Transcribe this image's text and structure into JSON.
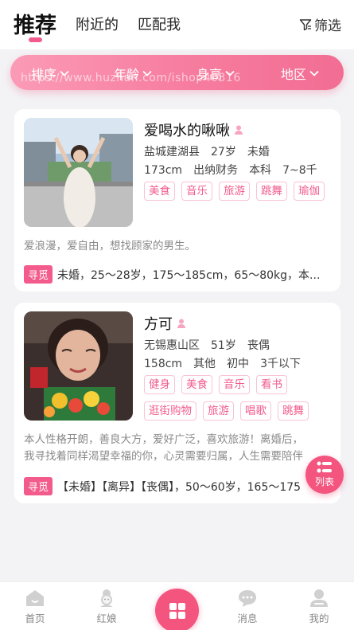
{
  "header": {
    "tab_recommend": "推荐",
    "tab_nearby": "附近的",
    "tab_match": "匹配我",
    "filter_label": "筛选"
  },
  "filter_bar": {
    "sort": "排序",
    "age": "年龄",
    "height": "身高",
    "region": "地区",
    "watermark": "https://www.huzhan.com/ishop40316"
  },
  "cards": [
    {
      "name": "爱喝水的啾啾",
      "location": "盐城建湖县",
      "age": "27岁",
      "marital": "未婚",
      "height": "173cm",
      "job": "出纳财务",
      "education": "本科",
      "income": "7~8千",
      "tags": [
        "美食",
        "音乐",
        "旅游",
        "跳舞",
        "瑜伽"
      ],
      "bio": "爱浪漫，爱自由，想找顾家的男生。",
      "seek_label": "寻觅",
      "seek_text": "未婚，25～28岁，175～185cm，65～80kg，本..."
    },
    {
      "name": "方可",
      "location": "无锡惠山区",
      "age": "51岁",
      "marital": "丧偶",
      "height": "158cm",
      "job": "其他",
      "education": "初中",
      "income": "3千以下",
      "tags": [
        "健身",
        "美食",
        "音乐",
        "看书",
        "逛街购物",
        "旅游",
        "唱歌",
        "跳舞"
      ],
      "bio": "本人性格开朗，善良大方，爱好广泛，喜欢旅游！离婚后，我寻找着同样渴望幸福的你，心灵需要归属，人生需要陪伴",
      "seek_label": "寻觅",
      "seek_text": "【未婚】【离异】【丧偶】，50～60岁，165～175"
    }
  ],
  "fab": {
    "label": "列表"
  },
  "tabbar": {
    "home": "首页",
    "matchmaker": "红娘",
    "messages": "消息",
    "mine": "我的"
  },
  "colors": {
    "accent": "#f25b8c"
  }
}
